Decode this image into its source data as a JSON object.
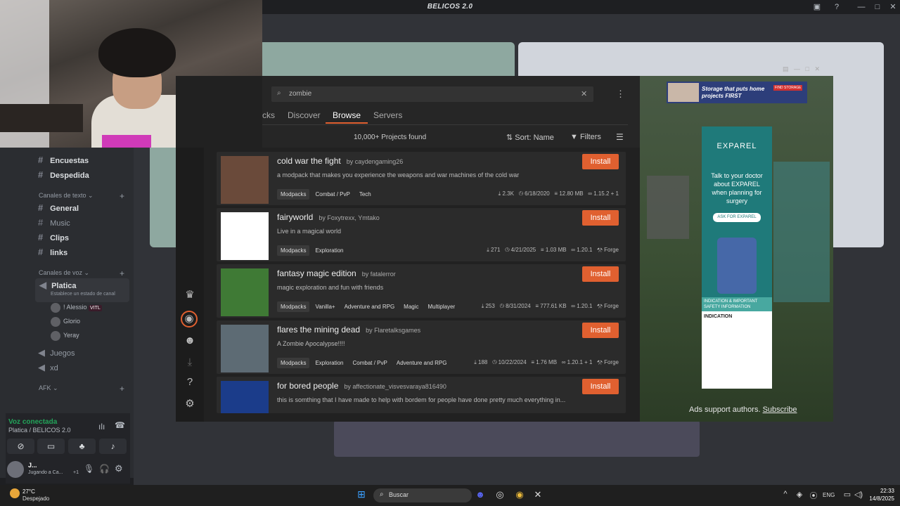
{
  "window": {
    "title": "BELICOS 2.0"
  },
  "discord": {
    "channels_top": [
      {
        "label": "Encuestas",
        "icon": "#"
      },
      {
        "label": "Despedida",
        "icon": "#"
      }
    ],
    "text_category": "Canales de texto",
    "text_channels": [
      {
        "label": "General"
      },
      {
        "label": "Music"
      },
      {
        "label": "Clips"
      },
      {
        "label": "links"
      }
    ],
    "voice_category": "Canales de voz",
    "voice_channel": {
      "label": "Platica",
      "status": "Establece un estado de canal"
    },
    "voice_users": [
      {
        "name": "! Alessio",
        "badge": "VITL"
      },
      {
        "name": "Glorio"
      },
      {
        "name": "Yeray"
      }
    ],
    "other_voice": [
      {
        "label": "Juegos"
      },
      {
        "label": "xd"
      }
    ],
    "afk_category": "AFK",
    "voice_status": {
      "title": "Voz conectada",
      "subtitle": "Platica / BELICOS 2.0"
    },
    "user": {
      "name": "J...",
      "status": "Jugando a Ca...",
      "extra": "+1"
    }
  },
  "launcher": {
    "search": {
      "value": "zombie"
    },
    "tabs": [
      "cks",
      "Discover",
      "Browse",
      "Servers"
    ],
    "active_tab": "Browse",
    "count": "10,000+ Projects found",
    "sort": "Sort: Name",
    "filters": "Filters",
    "install_label": "Install",
    "projects": [
      {
        "title": "cold war the fight",
        "author": "by caydengaming26",
        "desc": "a modpack that makes you experience the weapons and war machines of the cold war",
        "tags": [
          "Modpacks",
          "Combat / PvP",
          "Tech"
        ],
        "downloads": "2.3K",
        "date": "6/18/2020",
        "size": "12.80 MB",
        "version": "1.15.2 + 1",
        "loader": "",
        "thumb": "#6a4a3a"
      },
      {
        "title": "fairyworld",
        "author": "by Foxytrexx, Ymtako",
        "desc": "Live in a magical world",
        "tags": [
          "Modpacks",
          "Exploration"
        ],
        "downloads": "271",
        "date": "4/21/2025",
        "size": "1.03 MB",
        "version": "1.20.1",
        "loader": "Forge",
        "thumb": "#ffffff"
      },
      {
        "title": "fantasy magic edition",
        "author": "by fatalerror",
        "desc": "magic exploration and fun with friends",
        "tags": [
          "Modpacks",
          "Vanilla+",
          "Adventure and RPG",
          "Magic",
          "Multiplayer"
        ],
        "downloads": "253",
        "date": "8/31/2024",
        "size": "777.61 KB",
        "version": "1.20.1",
        "loader": "Forge",
        "thumb": "#3f7a35"
      },
      {
        "title": "flares the mining dead",
        "author": "by Flaretalksgames",
        "desc": "A Zombie Apocalypse!!!!",
        "tags": [
          "Modpacks",
          "Exploration",
          "Combat / PvP",
          "Adventure and RPG"
        ],
        "downloads": "188",
        "date": "10/22/2024",
        "size": "1.76 MB",
        "version": "1.20.1 + 1",
        "loader": "Forge",
        "thumb": "#5d6b74"
      },
      {
        "title": "for bored people",
        "author": "by affectionate_visvesvaraya816490",
        "desc": "this is somthing that I have made to help with bordem for people have done pretty much everything in...",
        "tags": [],
        "downloads": "",
        "date": "",
        "size": "",
        "version": "",
        "loader": "",
        "thumb": "#1b3c8a"
      }
    ]
  },
  "ads": {
    "banner": "Storage that puts home projects FIRST",
    "banner_btn": "FIND STORAGE",
    "exparel_brand": "EXPAREL",
    "exparel_text": "Talk to your doctor about EXPAREL when planning for surgery",
    "exparel_btn": "ASK FOR EXPAREL",
    "exparel_section": "INDICATION & IMPORTANT SAFETY INFORMATION",
    "exparel_ind": "INDICATION",
    "support": "Ads support authors.",
    "subscribe": "Subscribe"
  },
  "taskbar": {
    "weather_temp": "27°C",
    "weather_desc": "Despejado",
    "search": "Buscar",
    "lang": "ENG",
    "time": "22:33",
    "date": "14/8/2025"
  }
}
